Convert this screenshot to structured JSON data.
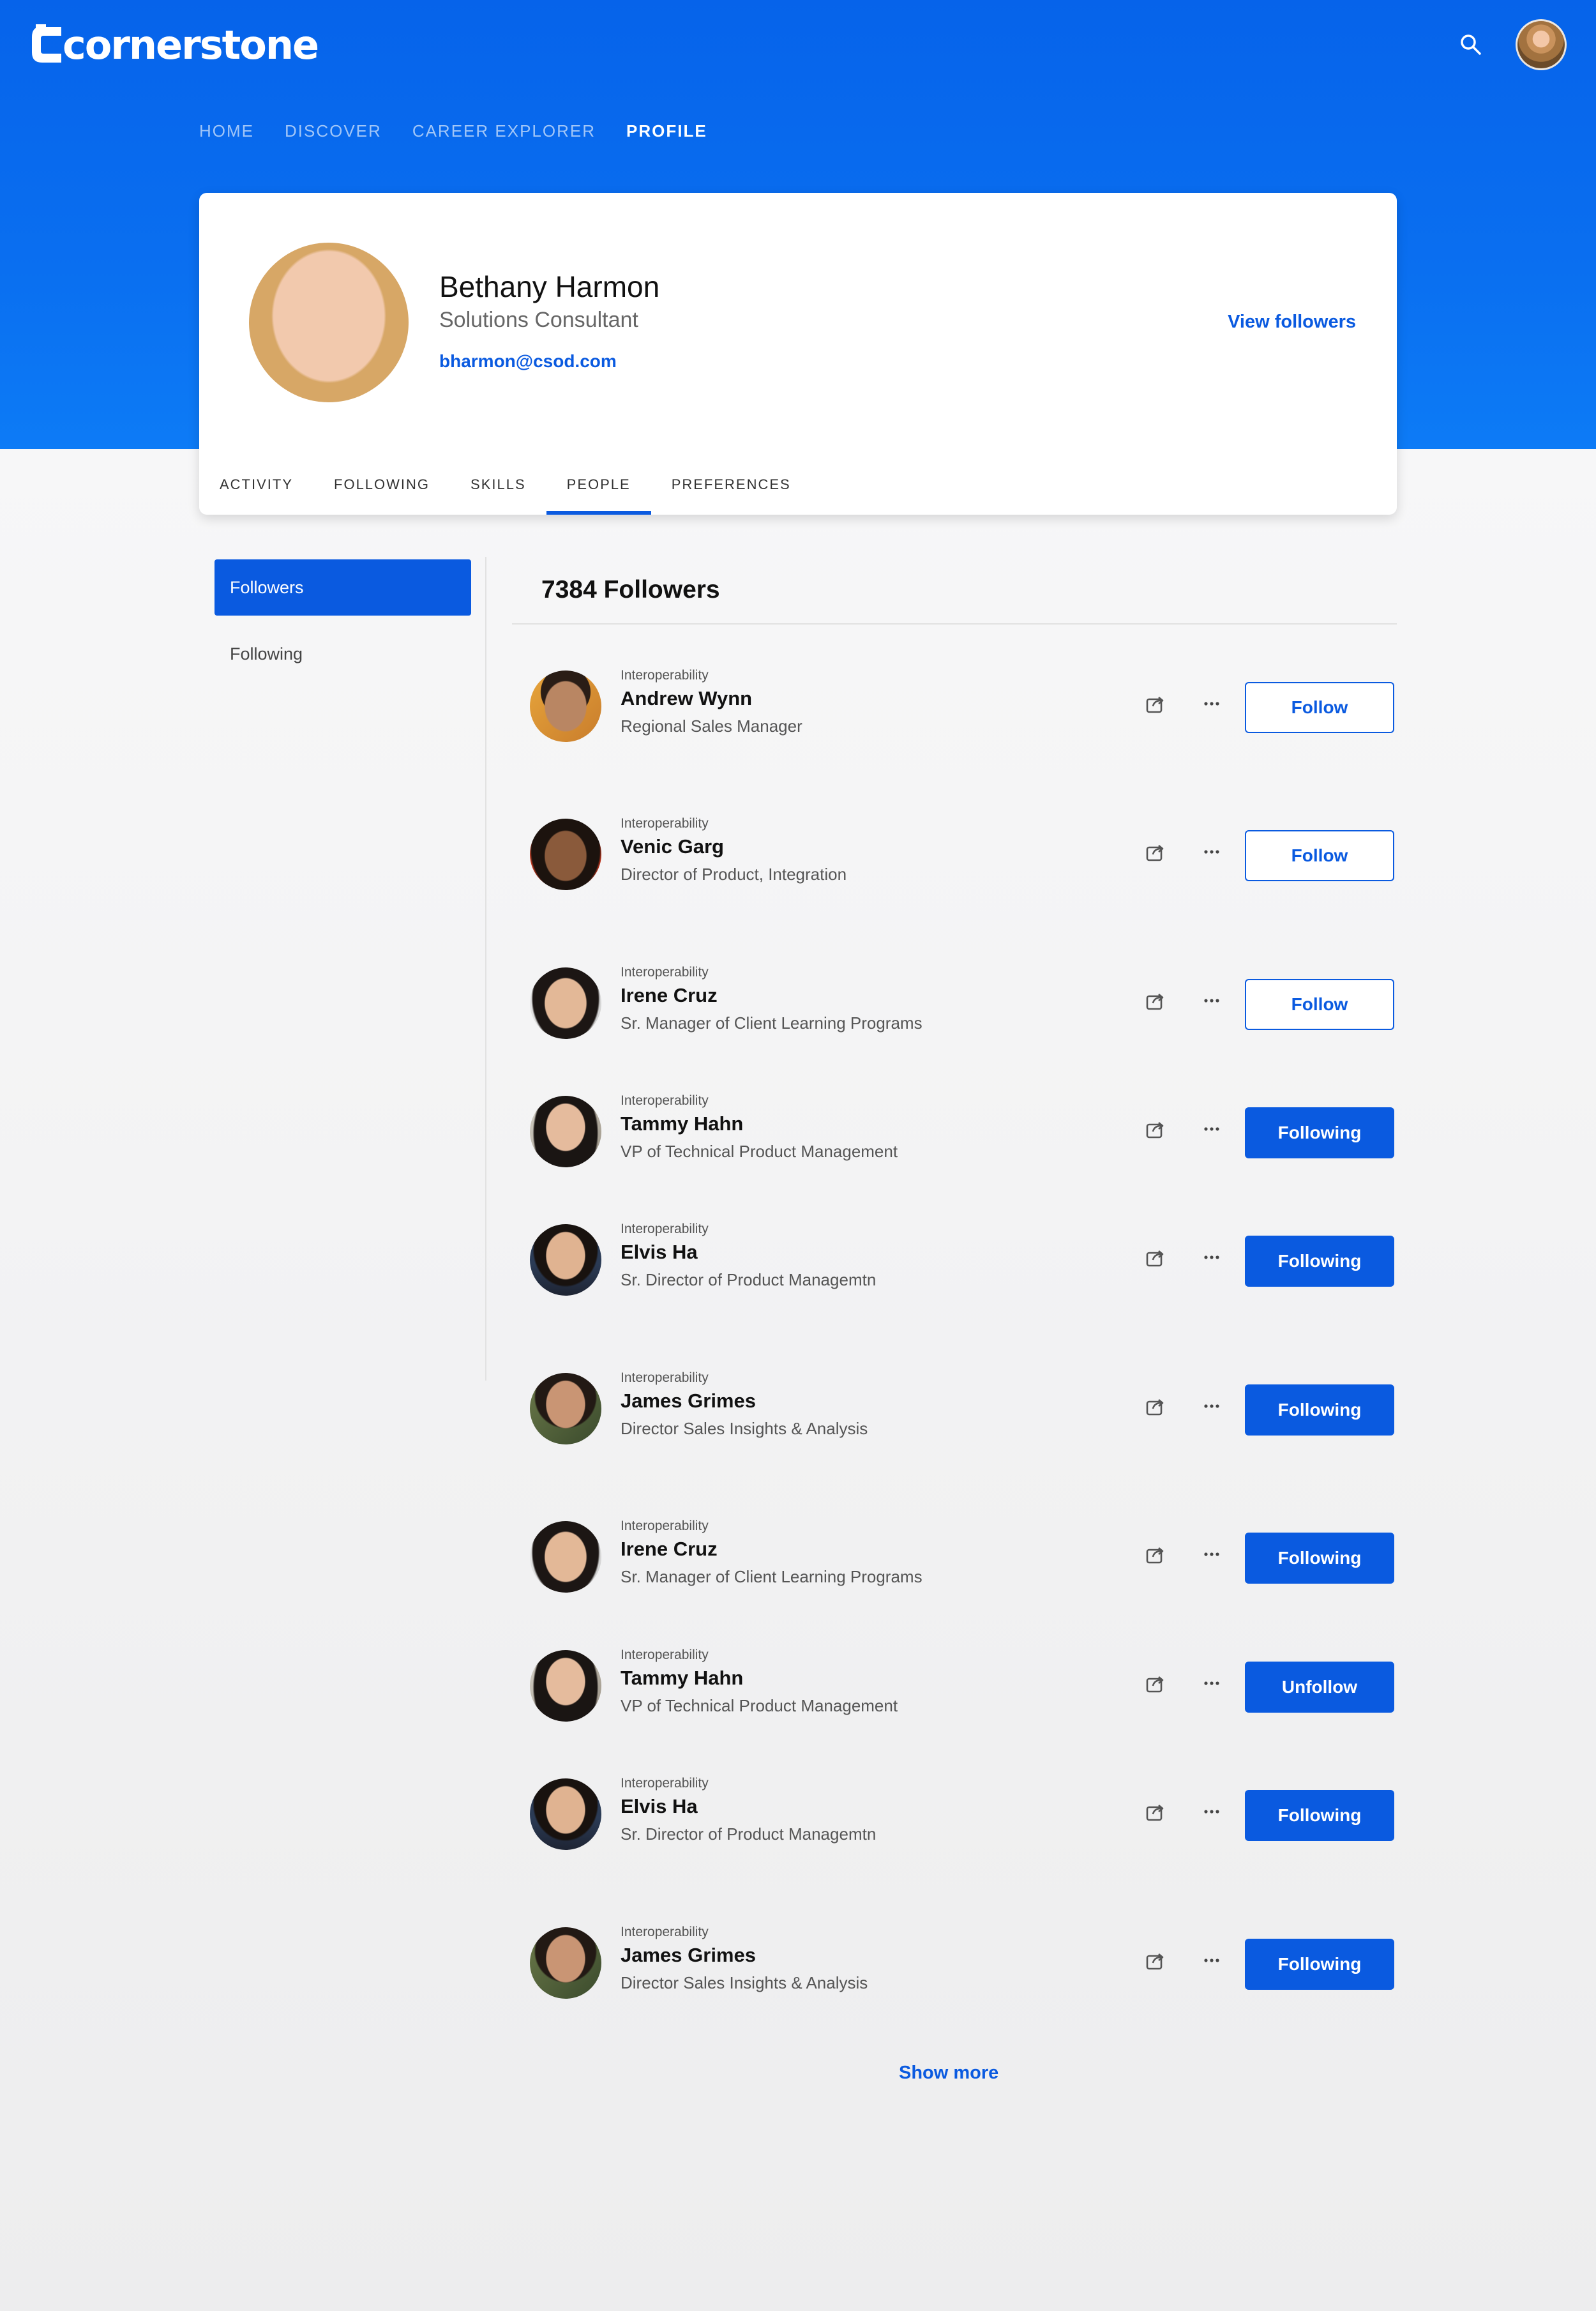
{
  "app": {
    "brand": "cornerstone",
    "accent_color": "#0a5ae0",
    "header_gradient": [
      "#0663ea",
      "#0d7bf6"
    ]
  },
  "topnav": {
    "items": [
      {
        "label": "HOME",
        "active": false
      },
      {
        "label": "DISCOVER",
        "active": false
      },
      {
        "label": "CAREER EXPLORER",
        "active": false
      },
      {
        "label": "PROFILE",
        "active": true
      }
    ]
  },
  "header_icons": {
    "search": "search-icon",
    "avatar": "user-avatar"
  },
  "profile": {
    "name": "Bethany Harmon",
    "title": "Solutions Consultant",
    "email": "bharmon@csod.com",
    "view_followers_label": "View followers",
    "tabs": [
      {
        "label": "ACTIVITY",
        "active": false
      },
      {
        "label": "FOLLOWING",
        "active": false
      },
      {
        "label": "SKILLS",
        "active": false
      },
      {
        "label": "PEOPLE",
        "active": true
      },
      {
        "label": "PREFERENCES",
        "active": false
      }
    ]
  },
  "sidebar": {
    "items": [
      {
        "label": "Followers",
        "active": true
      },
      {
        "label": "Following",
        "active": false
      }
    ]
  },
  "followers": {
    "title": "7384 Followers",
    "people": [
      {
        "group": "Interoperability",
        "name": "Andrew Wynn",
        "role": "Regional Sales Manager",
        "action": "Follow",
        "style": "outline"
      },
      {
        "group": "Interoperability",
        "name": "Venic Garg",
        "role": "Director of Product, Integration",
        "action": "Follow",
        "style": "outline"
      },
      {
        "group": "Interoperability",
        "name": "Irene Cruz",
        "role": "Sr. Manager of Client Learning Programs",
        "action": "Follow",
        "style": "outline"
      },
      {
        "group": "Interoperability",
        "name": "Tammy Hahn",
        "role": "VP of Technical Product Management",
        "action": "Following",
        "style": "solid"
      },
      {
        "group": "Interoperability",
        "name": "Elvis Ha",
        "role": "Sr. Director of Product Managemtn",
        "action": "Following",
        "style": "solid"
      },
      {
        "group": "Interoperability",
        "name": "James Grimes",
        "role": "Director Sales Insights & Analysis",
        "action": "Following",
        "style": "solid"
      },
      {
        "group": "Interoperability",
        "name": "Irene Cruz",
        "role": "Sr. Manager of Client Learning Programs",
        "action": "Following",
        "style": "solid"
      },
      {
        "group": "Interoperability",
        "name": "Tammy Hahn",
        "role": "VP of Technical Product Management",
        "action": "Unfollow",
        "style": "solid"
      },
      {
        "group": "Interoperability",
        "name": "Elvis Ha",
        "role": "Sr. Director of Product Managemtn",
        "action": "Following",
        "style": "solid"
      },
      {
        "group": "Interoperability",
        "name": "James Grimes",
        "role": "Director Sales Insights & Analysis",
        "action": "Following",
        "style": "solid"
      }
    ],
    "show_more_label": "Show more"
  }
}
